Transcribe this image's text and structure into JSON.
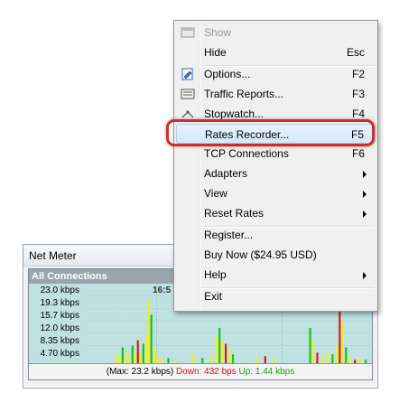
{
  "net_meter": {
    "title": "Net Meter",
    "graph_header": "All Connections",
    "time_label": "16:5",
    "y_labels": [
      "23.0 kbps",
      "19.3 kbps",
      "15.7 kbps",
      "12.0 kbps",
      "8.35 kbps",
      "4.70 kbps"
    ],
    "status": {
      "max": "(Max: 23.2 kbps)",
      "down": "Down: 432 bps",
      "up": "Up: 1.44 kbps"
    },
    "colors": {
      "background": "#bfe1e1",
      "download": "#e01818",
      "upload": "#18c018",
      "both": "#f0f020"
    }
  },
  "menu": {
    "items": [
      {
        "label": "Show",
        "shortcut": "",
        "icon": "window-icon",
        "disabled": true
      },
      {
        "label": "Hide",
        "shortcut": "Esc"
      },
      {
        "label": "Options...",
        "shortcut": "F2",
        "icon": "options-icon"
      },
      {
        "label": "Traffic Reports...",
        "shortcut": "F3",
        "icon": "report-icon"
      },
      {
        "label": "Stopwatch...",
        "shortcut": "F4",
        "icon": "stopwatch-icon"
      },
      {
        "label": "Rates Recorder...",
        "shortcut": "F5",
        "selected": true
      },
      {
        "label": "TCP Connections",
        "shortcut": "F6"
      },
      {
        "label": "Adapters",
        "submenu": true
      },
      {
        "label": "View",
        "submenu": true
      },
      {
        "label": "Reset Rates",
        "submenu": true
      },
      {
        "label": "Register..."
      },
      {
        "label": "Buy Now ($24.95 USD)"
      },
      {
        "label": "Help",
        "submenu": true
      },
      {
        "label": "Exit"
      }
    ]
  }
}
